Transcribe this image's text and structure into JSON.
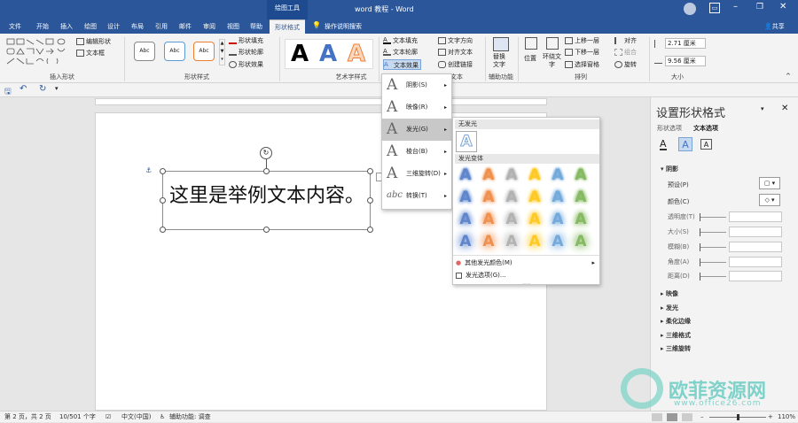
{
  "title": {
    "context_group": "绘图工具",
    "doc": "word 教程 - Word",
    "share": "共享",
    "tell": "操作说明搜索"
  },
  "tabs": [
    "文件",
    "开始",
    "插入",
    "绘图",
    "设计",
    "布局",
    "引用",
    "邮件",
    "审阅",
    "视图",
    "帮助",
    "形状格式"
  ],
  "ribbon": {
    "groups": [
      "插入形状",
      "形状样式",
      "艺术字样式",
      "文本",
      "辅助功能",
      "排列",
      "大小"
    ],
    "edit_shape": "编辑形状",
    "text_box": "文本框",
    "style_abc": "Abc",
    "shape_fill": "形状填充",
    "shape_outline": "形状轮廓",
    "shape_effects": "形状效果",
    "text_fill": "文本填充",
    "text_outline": "文本轮廓",
    "text_effects": "文本效果",
    "text_direction": "文字方向",
    "align_text": "对齐文本",
    "create_link": "创建链接",
    "alt_text": "替换\n文字",
    "position": "位置",
    "wrap_text": "环绕文\n字",
    "bring_forward": "上移一层",
    "send_backward": "下移一层",
    "selection_pane": "选择窗格",
    "align": "对齐",
    "group": "组合",
    "rotate": "旋转",
    "height": "2.71 厘米",
    "width": "9.56 厘米",
    "wordart_letter": "A"
  },
  "doc_text": "这里是举例文本内容。",
  "menu1": [
    {
      "label": "阴影(S)",
      "icon": "A"
    },
    {
      "label": "映像(R)",
      "icon": "A"
    },
    {
      "label": "发光(G)",
      "icon": "A"
    },
    {
      "label": "棱台(B)",
      "icon": "A"
    },
    {
      "label": "三维旋转(D)",
      "icon": "A"
    },
    {
      "label": "转换(T)",
      "icon": "abc"
    }
  ],
  "menu2": {
    "no_glow": "无发光",
    "variants": "发光变体",
    "more_colors": "其他发光颜色(M)",
    "options": "发光选项(G)...",
    "letter": "A",
    "colors": [
      "#4472c4",
      "#ed7d31",
      "#a5a5a5",
      "#ffc000",
      "#5b9bd5",
      "#70ad47"
    ]
  },
  "pane": {
    "title": "设置形状格式",
    "tab1": "形状选项",
    "tab2": "文本选项",
    "section": "阴影",
    "rows": [
      "预设(P)",
      "颜色(C)",
      "透明度(T)",
      "大小(S)",
      "模糊(B)",
      "角度(A)",
      "距离(D)"
    ],
    "collapsed": [
      "映像",
      "发光",
      "柔化边缘",
      "三维格式",
      "三维旋转"
    ]
  },
  "status": {
    "page": "第 2 页，共 2 页",
    "words": "10/501 个字",
    "lang": "中文(中国)",
    "access": "辅助功能: 调查",
    "zoom": "110%"
  },
  "watermark": {
    "brand": "欧菲资源网",
    "url": "www.office26.com"
  }
}
